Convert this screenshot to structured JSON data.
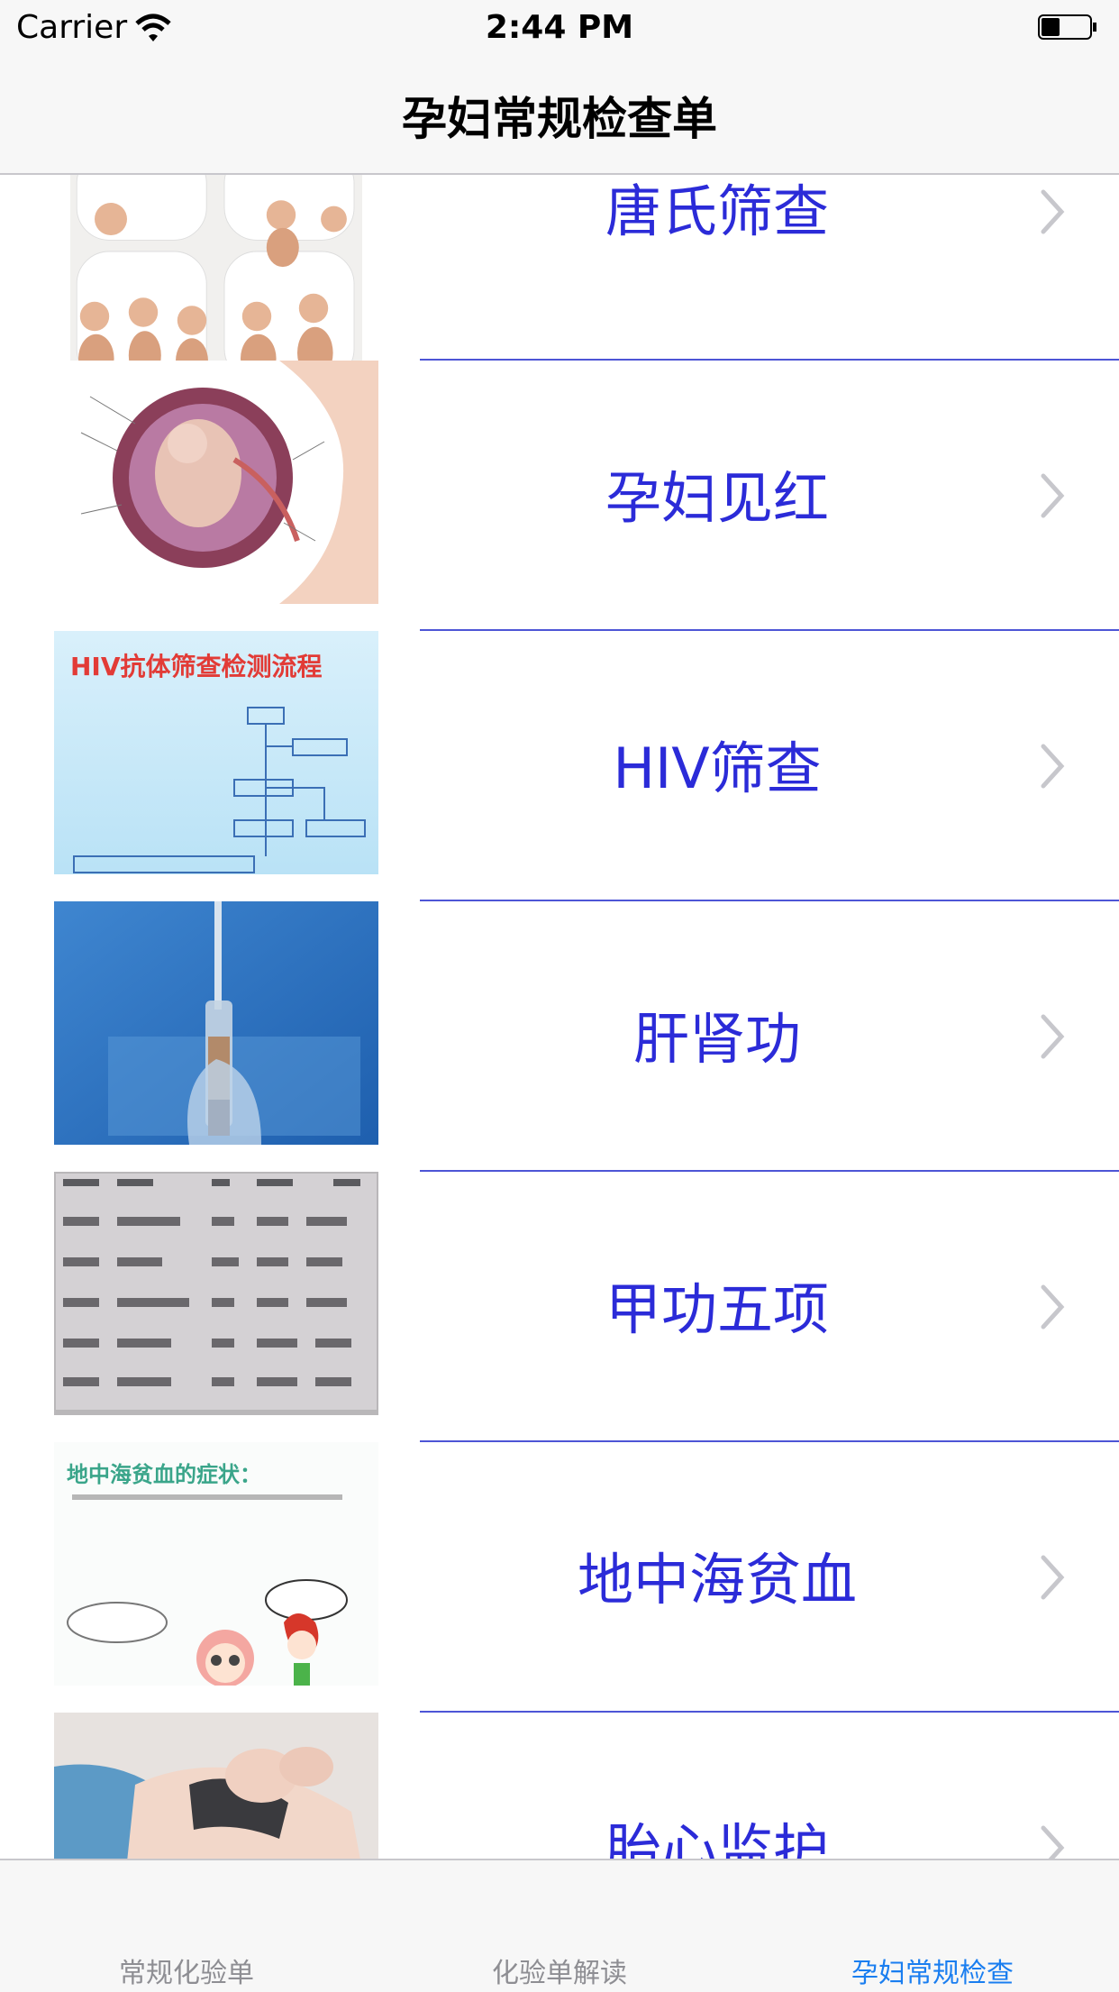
{
  "status_bar": {
    "carrier": "Carrier",
    "time": "2:44 PM",
    "battery_level": 0.35
  },
  "nav": {
    "title": "孕妇常规检查单"
  },
  "list": {
    "items": [
      {
        "label": "唐氏筛查",
        "thumb": "baby-photo-icon"
      },
      {
        "label": "孕妇见红",
        "thumb": "fetus-diagram-icon"
      },
      {
        "label": "HIV筛查",
        "thumb": "hiv-flowchart-icon"
      },
      {
        "label": "肝肾功",
        "thumb": "test-tube-icon"
      },
      {
        "label": "甲功五项",
        "thumb": "lab-report-icon"
      },
      {
        "label": "地中海贫血",
        "thumb": "cartoon-anemia-icon"
      },
      {
        "label": "胎心监护",
        "thumb": "belly-monitor-icon"
      }
    ],
    "hiv_thumb_text": "HIV抗体筛查检测流程",
    "anemia_thumb_text": "地中海贫血的症状：",
    "accent_color": "#2b2bd8",
    "separator_color": "#4d55d6"
  },
  "tabs": [
    {
      "label": "常规化验单",
      "active": false
    },
    {
      "label": "化验单解读",
      "active": false
    },
    {
      "label": "孕妇常规检查",
      "active": true
    }
  ],
  "active_tab_color": "#1a7ef0"
}
